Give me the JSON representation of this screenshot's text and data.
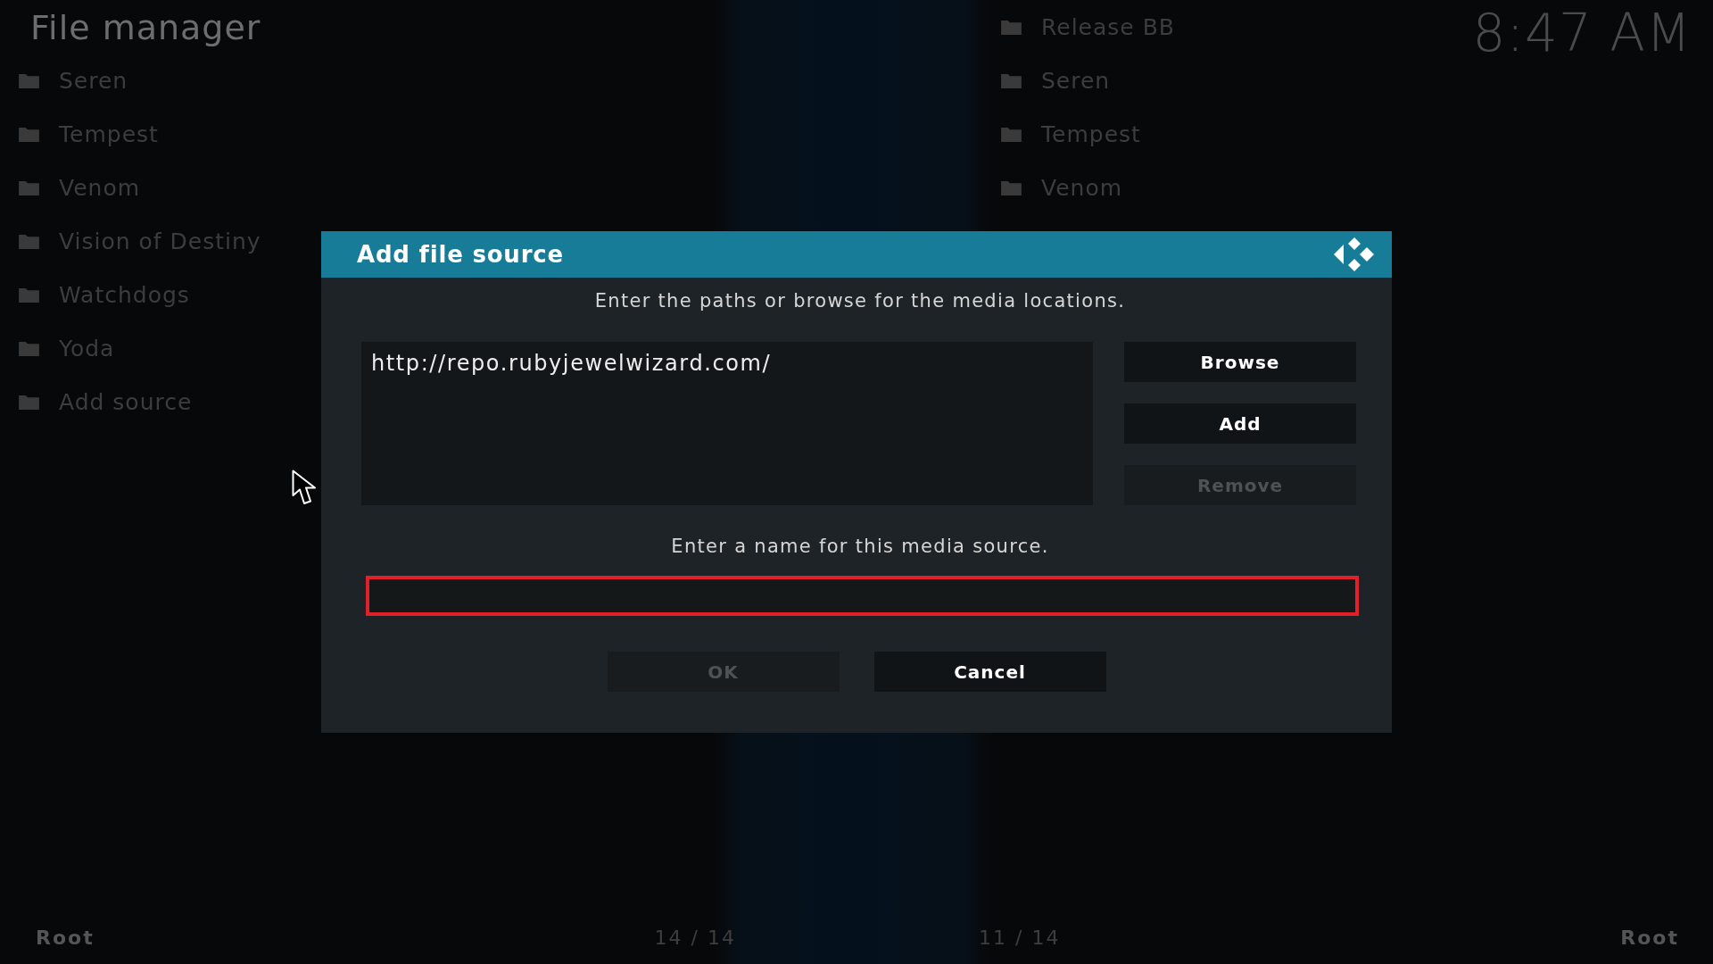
{
  "header": {
    "title": "File manager",
    "clock": "8:47 AM"
  },
  "left_panel": {
    "items": [
      {
        "label": "Seren"
      },
      {
        "label": "Tempest"
      },
      {
        "label": "Venom"
      },
      {
        "label": "Vision of Destiny"
      },
      {
        "label": "Watchdogs"
      },
      {
        "label": "Yoda"
      },
      {
        "label": "Add source"
      }
    ],
    "path": "Root",
    "count": "14 / 14"
  },
  "right_panel": {
    "items": [
      {
        "label": "Release BB"
      },
      {
        "label": "Seren"
      },
      {
        "label": "Tempest"
      },
      {
        "label": "Venom"
      }
    ],
    "path": "Root",
    "count": "11 / 14"
  },
  "dialog": {
    "title": "Add file source",
    "paths_prompt": "Enter the paths or browse for the media locations.",
    "paths": [
      "http://repo.rubyjewelwizard.com/"
    ],
    "side_buttons": [
      {
        "label": "Browse",
        "disabled": false
      },
      {
        "label": "Add",
        "disabled": false
      },
      {
        "label": "Remove",
        "disabled": true
      }
    ],
    "name_prompt": "Enter a name for this media source.",
    "name_field": {
      "highlighted": true
    },
    "buttons": [
      {
        "label": "OK",
        "disabled": true
      },
      {
        "label": "Cancel",
        "disabled": false
      }
    ]
  }
}
